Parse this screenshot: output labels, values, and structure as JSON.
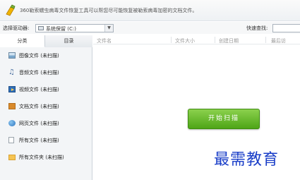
{
  "banner": {
    "icon": "brush-icon",
    "text": "360勒索蠕虫病毒文件恢复工具可以帮您尽可能恢复被勒索病毒加密的文档文件。"
  },
  "toolbar": {
    "drive_label": "选择驱动器:",
    "drive_value": "系统保留 (C:)",
    "quick_search_label": "快速查找:",
    "quick_search_value": ""
  },
  "sidebar": {
    "tabs": [
      {
        "label": "分类"
      },
      {
        "label": "目录"
      }
    ],
    "categories": [
      {
        "label": "图像文件 (未扫描)",
        "icon": "image-icon"
      },
      {
        "label": "音频文件 (未扫描)",
        "icon": "music-note-icon"
      },
      {
        "label": "视频文件 (未扫描)",
        "icon": "video-icon"
      },
      {
        "label": "文档文件 (未扫描)",
        "icon": "document-icon"
      },
      {
        "label": "网页文件 (未扫描)",
        "icon": "globe-icon"
      },
      {
        "label": "所有文件 (未扫描)",
        "icon": "file-icon"
      },
      {
        "label": "所有文件夹 (未扫描)",
        "icon": "folder-icon"
      }
    ]
  },
  "file_list": {
    "columns": [
      "文件名",
      "文件大小",
      "创建日期",
      "最后访"
    ]
  },
  "scan_button": {
    "label": "开始扫描"
  },
  "watermark": {
    "text": "最需教育"
  },
  "colors": {
    "accent_green": "#4ea517",
    "watermark_blue": "#1a3ec8"
  }
}
